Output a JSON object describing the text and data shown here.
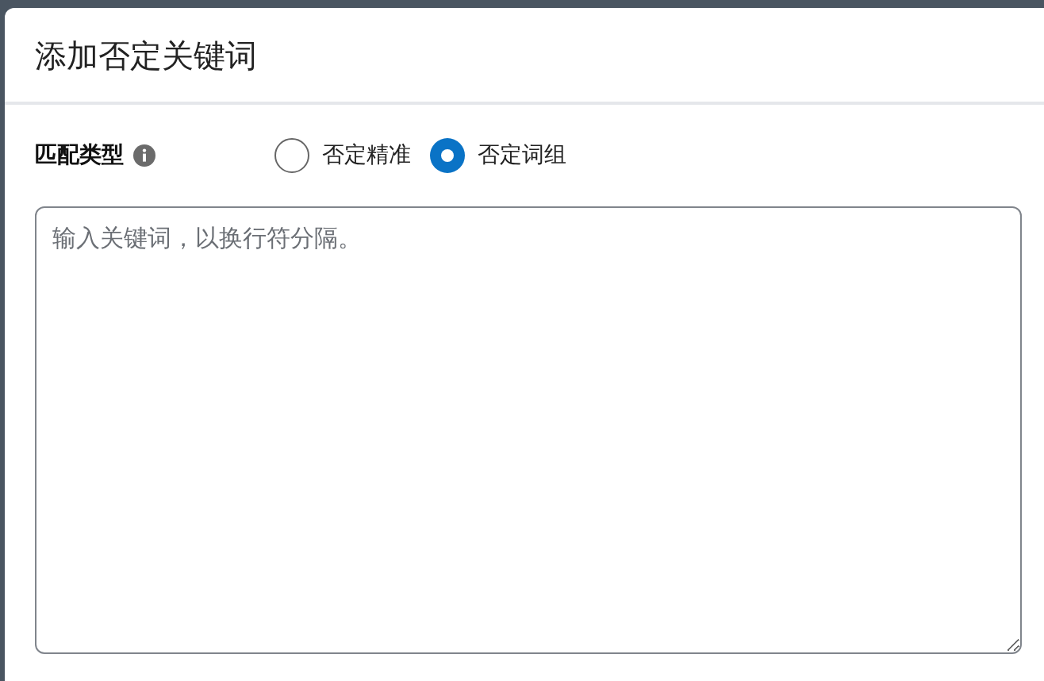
{
  "dialog": {
    "title": "添加否定关键词"
  },
  "match_type": {
    "label": "匹配类型",
    "options": [
      {
        "label": "否定精准",
        "selected": false
      },
      {
        "label": "否定词组",
        "selected": true
      }
    ]
  },
  "keywords_field": {
    "placeholder": "输入关键词，以换行符分隔。"
  }
}
